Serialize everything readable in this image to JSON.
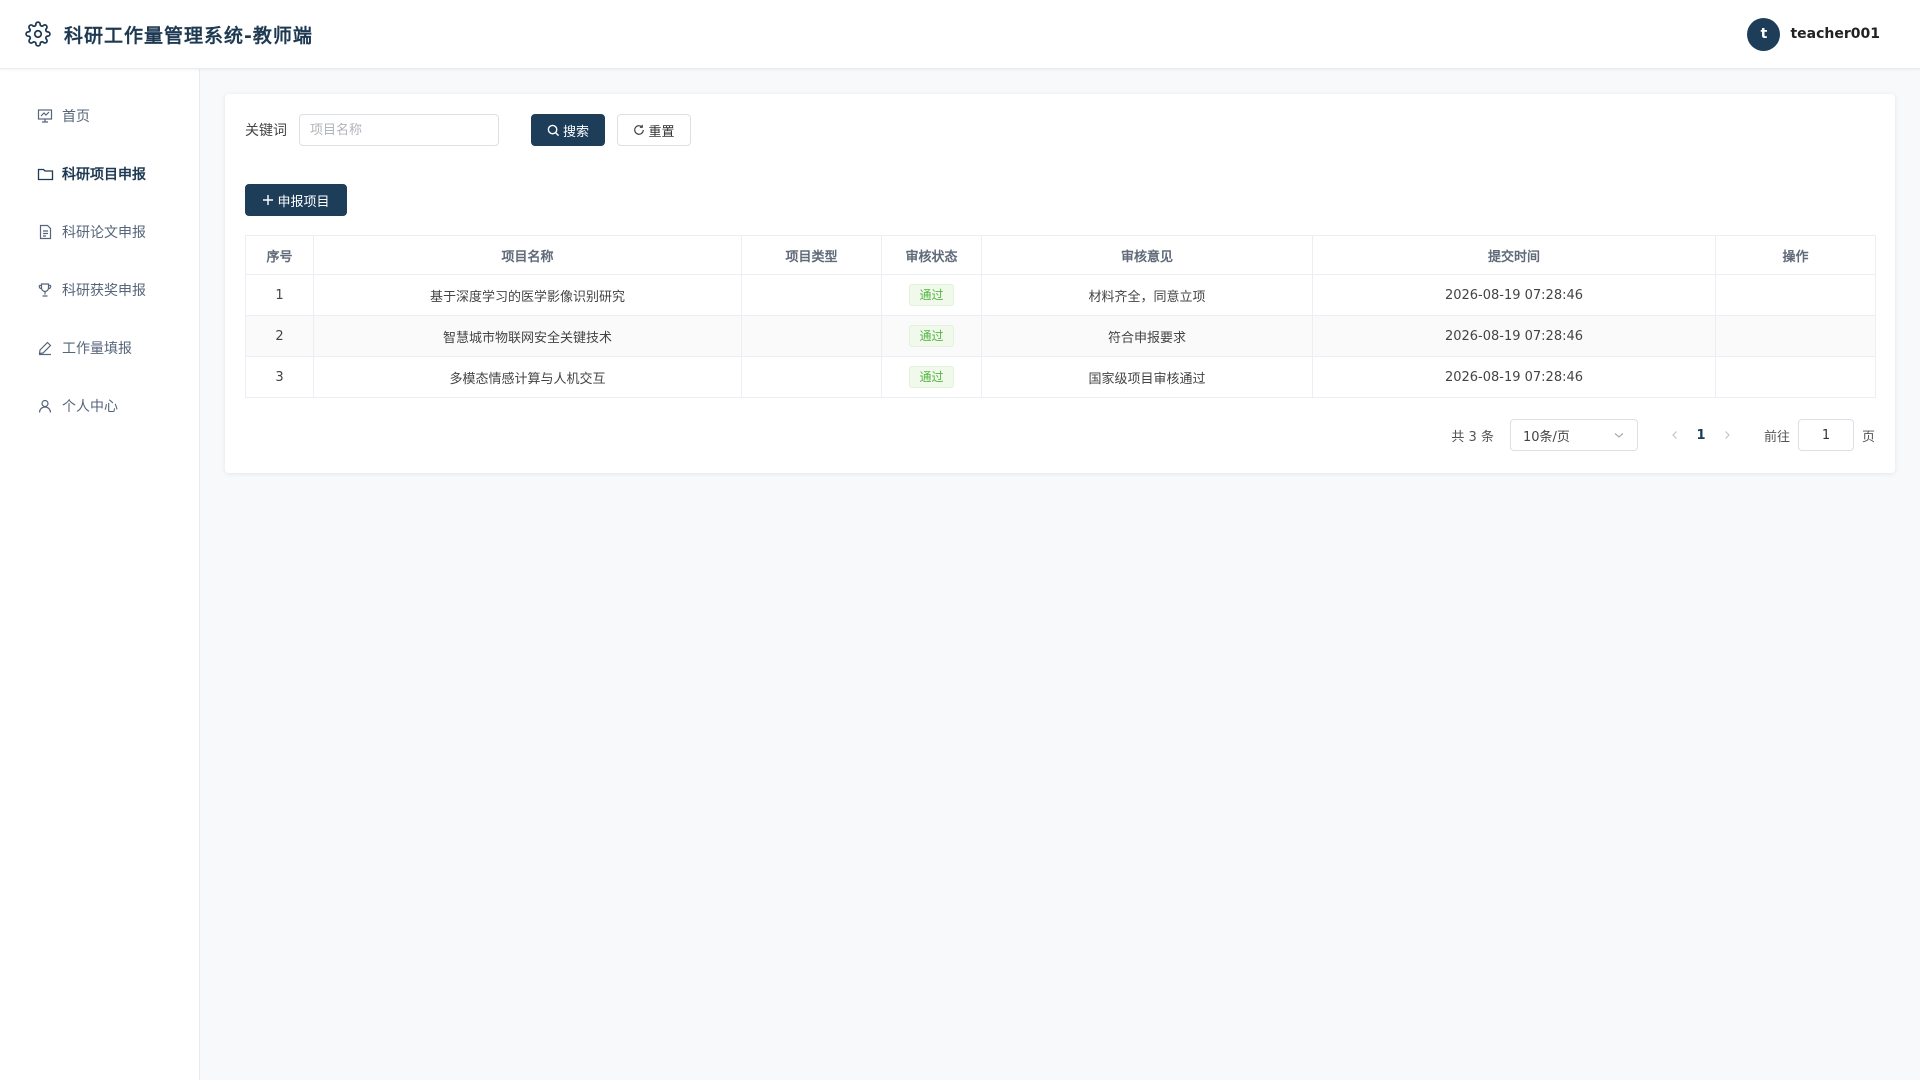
{
  "header": {
    "title": "科研工作量管理系统-教师端",
    "avatar_letter": "t",
    "username": "teacher001"
  },
  "sidebar": {
    "items": [
      {
        "label": "首页",
        "icon": "presentation-icon",
        "active": false
      },
      {
        "label": "科研项目申报",
        "icon": "folder-icon",
        "active": true
      },
      {
        "label": "科研论文申报",
        "icon": "document-icon",
        "active": false
      },
      {
        "label": "科研获奖申报",
        "icon": "trophy-icon",
        "active": false
      },
      {
        "label": "工作量填报",
        "icon": "edit-pen-icon",
        "active": false
      },
      {
        "label": "个人中心",
        "icon": "user-icon",
        "active": false
      }
    ]
  },
  "search": {
    "label": "关键词",
    "placeholder": "项目名称",
    "value": "",
    "search_label": "搜索",
    "reset_label": "重置"
  },
  "add_button_label": "申报项目",
  "table": {
    "columns": [
      "序号",
      "项目名称",
      "项目类型",
      "审核状态",
      "审核意见",
      "提交时间",
      "操作"
    ],
    "rows": [
      {
        "index": "1",
        "name": "基于深度学习的医学影像识别研究",
        "type": "",
        "status": "通过",
        "opinion": "材料齐全，同意立项",
        "time": "2026-08-19 07:28:46",
        "action": ""
      },
      {
        "index": "2",
        "name": "智慧城市物联网安全关键技术",
        "type": "",
        "status": "通过",
        "opinion": "符合申报要求",
        "time": "2026-08-19 07:28:46",
        "action": ""
      },
      {
        "index": "3",
        "name": "多模态情感计算与人机交互",
        "type": "",
        "status": "通过",
        "opinion": "国家级项目审核通过",
        "time": "2026-08-19 07:28:46",
        "action": ""
      }
    ]
  },
  "pagination": {
    "total_text": "共 3 条",
    "page_size": "10条/页",
    "current_page": "1",
    "goto_label": "前往",
    "goto_value": "1",
    "page_suffix": "页"
  },
  "colors": {
    "primary": "#1d3d58",
    "success_text": "#52b540",
    "success_bg": "#f0f9eb"
  }
}
